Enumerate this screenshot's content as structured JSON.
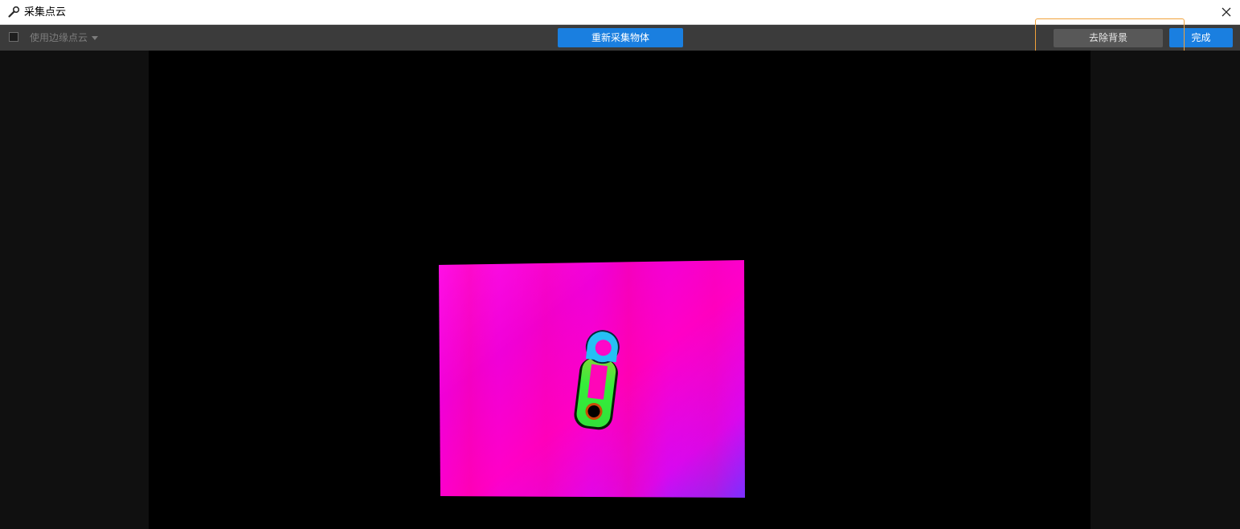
{
  "window": {
    "title": "采集点云",
    "title_icon": "wrench-icon",
    "close_icon": "close-icon"
  },
  "toolbar": {
    "edge_checkbox_label": "使用边缘点云",
    "edge_checkbox_checked": false,
    "recapture_label": "重新采集物体",
    "remove_background_label": "去除背景",
    "done_label": "完成"
  },
  "colors": {
    "primary_button": "#1a7fe0",
    "highlight_outline": "#f2a23a",
    "background_cloud": "#ff00d8",
    "object_top": "#1fd0f0",
    "object_body": "#3cf03c"
  }
}
